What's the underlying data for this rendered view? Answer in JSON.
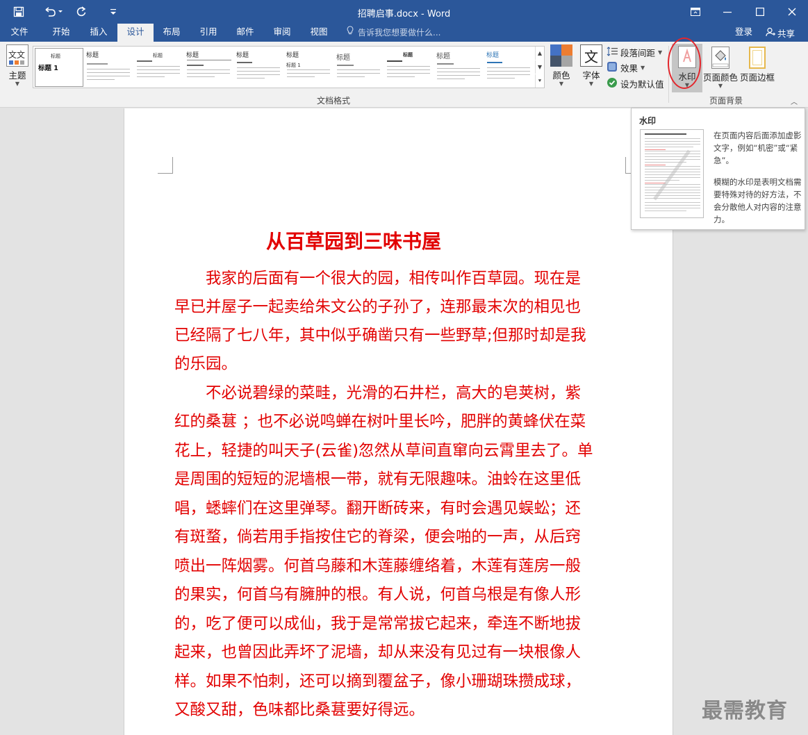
{
  "window": {
    "title": "招聘启事.docx - Word",
    "titlebar_color": "#2b579a"
  },
  "quick_access": [
    "save-icon",
    "undo-icon",
    "redo-icon",
    "customize-icon"
  ],
  "tabs": [
    {
      "label": "文件"
    },
    {
      "label": "开始"
    },
    {
      "label": "插入"
    },
    {
      "label": "设计"
    },
    {
      "label": "布局"
    },
    {
      "label": "引用"
    },
    {
      "label": "邮件"
    },
    {
      "label": "审阅"
    },
    {
      "label": "视图"
    }
  ],
  "active_tab": "设计",
  "tell_me": "告诉我您想要做什么...",
  "account": {
    "login": "登录",
    "share": "共享"
  },
  "ribbon": {
    "theme_label": "主题",
    "gallery_group_label": "文档格式",
    "gallery": {
      "item_heading": "标题",
      "first_item_title": "标题 1",
      "second_heading": "标题 1"
    },
    "colors_label": "颜色",
    "fonts_label": "字体",
    "fonts_glyph": "文",
    "theme_glyph": "文文",
    "paragraph_spacing": "段落间距",
    "effects": "效果",
    "set_default": "设为默认值",
    "watermark": "水印",
    "page_color": "页面颜色",
    "page_borders": "页面边框",
    "page_bg_group_label": "页面背景",
    "highlight_color": "#e3262c"
  },
  "tooltip": {
    "title": "水印",
    "desc1": "在页面内容后面添加虚影文字，例如“机密”或“紧急”。",
    "desc2": "模糊的水印是表明文档需要特殊对待的好方法，不会分散他人对内容的注意力。"
  },
  "document": {
    "heading": "从百草园到三味书屋",
    "text_color": "#e20000",
    "lines": [
      "　　我家的后面有一个很大的园，相传叫作百草园。现在是",
      "早已并屋子一起卖给朱文公的子孙了，连那最末次的相见也",
      "已经隔了七八年，其中似乎确凿只有一些野草;但那时却是我",
      "的乐园。",
      "　　不必说碧绿的菜畦，光滑的石井栏，高大的皂荚树，紫",
      "红的桑葚 ；也不必说鸣蝉在树叶里长吟，肥胖的黄蜂伏在菜",
      "花上，轻捷的叫天子(云雀)忽然从草间直窜向云霄里去了。单",
      "是周围的短短的泥墙根一带，就有无限趣味。油蛉在这里低",
      "唱，蟋蟀们在这里弹琴。翻开断砖来，有时会遇见蜈蚣；还",
      "有斑蝥，倘若用手指按住它的脊梁，便会啪的一声，从后窍",
      "喷出一阵烟雾。何首乌藤和木莲藤缠络着，木莲有莲房一般",
      "的果实，何首乌有臃肿的根。有人说，何首乌根是有像人形",
      "的，吃了便可以成仙，我于是常常拔它起来，牵连不断地拔",
      "起来，也曾因此弄坏了泥墙，却从来没有见过有一块根像人",
      "样。如果不怕刺，还可以摘到覆盆子，像小珊瑚珠攒成球，",
      "又酸又甜，色味都比桑葚要好得远。"
    ]
  },
  "brand_watermark": "最需教育"
}
